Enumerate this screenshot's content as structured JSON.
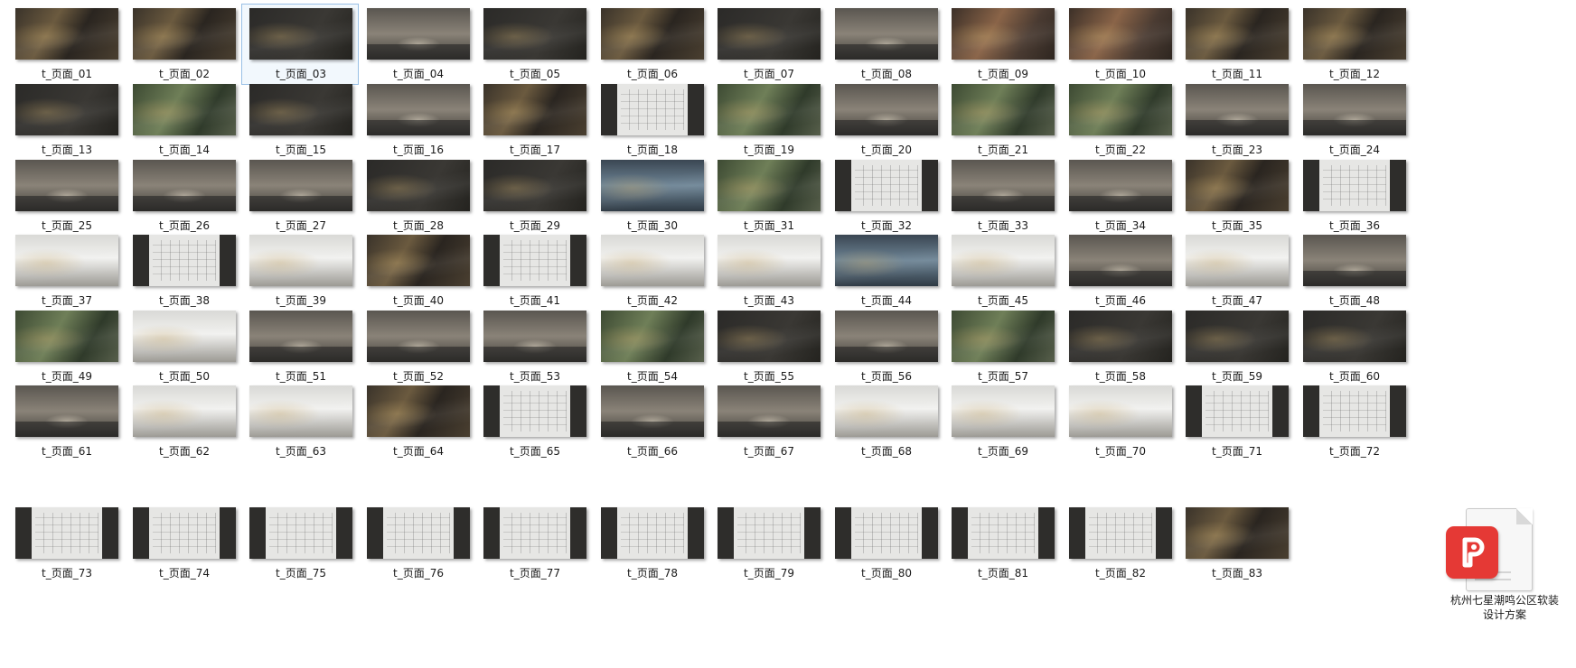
{
  "folder_items": [
    {
      "name": "t_页面_01",
      "style": "gold"
    },
    {
      "name": "t_页面_02",
      "style": "gold"
    },
    {
      "name": "t_页面_03",
      "style": "dark",
      "selected": true
    },
    {
      "name": "t_页面_04",
      "style": "room"
    },
    {
      "name": "t_页面_05",
      "style": "dark"
    },
    {
      "name": "t_页面_06",
      "style": "gold"
    },
    {
      "name": "t_页面_07",
      "style": "dark"
    },
    {
      "name": "t_页面_08",
      "style": "room"
    },
    {
      "name": "t_页面_09",
      "style": "people"
    },
    {
      "name": "t_页面_10",
      "style": "people"
    },
    {
      "name": "t_页面_11",
      "style": "gold"
    },
    {
      "name": "t_页面_12",
      "style": "gold"
    },
    {
      "name": "t_页面_13",
      "style": "dark"
    },
    {
      "name": "t_页面_14",
      "style": "green"
    },
    {
      "name": "t_页面_15",
      "style": "dark"
    },
    {
      "name": "t_页面_16",
      "style": "room"
    },
    {
      "name": "t_页面_17",
      "style": "gold"
    },
    {
      "name": "t_页面_18",
      "style": "plan"
    },
    {
      "name": "t_页面_19",
      "style": "green"
    },
    {
      "name": "t_页面_20",
      "style": "room"
    },
    {
      "name": "t_页面_21",
      "style": "green"
    },
    {
      "name": "t_页面_22",
      "style": "green"
    },
    {
      "name": "t_页面_23",
      "style": "room"
    },
    {
      "name": "t_页面_24",
      "style": "room"
    },
    {
      "name": "t_页面_25",
      "style": "room"
    },
    {
      "name": "t_页面_26",
      "style": "room"
    },
    {
      "name": "t_页面_27",
      "style": "room"
    },
    {
      "name": "t_页面_28",
      "style": "dark"
    },
    {
      "name": "t_页面_29",
      "style": "dark"
    },
    {
      "name": "t_页面_30",
      "style": "water"
    },
    {
      "name": "t_页面_31",
      "style": "green"
    },
    {
      "name": "t_页面_32",
      "style": "plan"
    },
    {
      "name": "t_页面_33",
      "style": "room"
    },
    {
      "name": "t_页面_34",
      "style": "room"
    },
    {
      "name": "t_页面_35",
      "style": "gold"
    },
    {
      "name": "t_页面_36",
      "style": "plan"
    },
    {
      "name": "t_页面_37",
      "style": "light"
    },
    {
      "name": "t_页面_38",
      "style": "plan"
    },
    {
      "name": "t_页面_39",
      "style": "light"
    },
    {
      "name": "t_页面_40",
      "style": "gold"
    },
    {
      "name": "t_页面_41",
      "style": "plan"
    },
    {
      "name": "t_页面_42",
      "style": "light"
    },
    {
      "name": "t_页面_43",
      "style": "light"
    },
    {
      "name": "t_页面_44",
      "style": "water"
    },
    {
      "name": "t_页面_45",
      "style": "light"
    },
    {
      "name": "t_页面_46",
      "style": "room"
    },
    {
      "name": "t_页面_47",
      "style": "light"
    },
    {
      "name": "t_页面_48",
      "style": "room"
    },
    {
      "name": "t_页面_49",
      "style": "green"
    },
    {
      "name": "t_页面_50",
      "style": "light"
    },
    {
      "name": "t_页面_51",
      "style": "room"
    },
    {
      "name": "t_页面_52",
      "style": "room"
    },
    {
      "name": "t_页面_53",
      "style": "room"
    },
    {
      "name": "t_页面_54",
      "style": "green"
    },
    {
      "name": "t_页面_55",
      "style": "dark"
    },
    {
      "name": "t_页面_56",
      "style": "room"
    },
    {
      "name": "t_页面_57",
      "style": "green"
    },
    {
      "name": "t_页面_58",
      "style": "dark"
    },
    {
      "name": "t_页面_59",
      "style": "dark"
    },
    {
      "name": "t_页面_60",
      "style": "dark"
    },
    {
      "name": "t_页面_61",
      "style": "room"
    },
    {
      "name": "t_页面_62",
      "style": "light"
    },
    {
      "name": "t_页面_63",
      "style": "light"
    },
    {
      "name": "t_页面_64",
      "style": "gold"
    },
    {
      "name": "t_页面_65",
      "style": "plan"
    },
    {
      "name": "t_页面_66",
      "style": "room"
    },
    {
      "name": "t_页面_67",
      "style": "room"
    },
    {
      "name": "t_页面_68",
      "style": "light"
    },
    {
      "name": "t_页面_69",
      "style": "light"
    },
    {
      "name": "t_页面_70",
      "style": "light"
    },
    {
      "name": "t_页面_71",
      "style": "plan"
    },
    {
      "name": "t_页面_72",
      "style": "plan"
    },
    {
      "name": "t_页面_73",
      "style": "plan"
    },
    {
      "name": "t_页面_74",
      "style": "plan"
    },
    {
      "name": "t_页面_75",
      "style": "plan"
    },
    {
      "name": "t_页面_76",
      "style": "plan"
    },
    {
      "name": "t_页面_77",
      "style": "plan"
    },
    {
      "name": "t_页面_78",
      "style": "plan"
    },
    {
      "name": "t_页面_79",
      "style": "plan"
    },
    {
      "name": "t_页面_80",
      "style": "plan"
    },
    {
      "name": "t_页面_81",
      "style": "plan"
    },
    {
      "name": "t_页面_82",
      "style": "plan"
    },
    {
      "name": "t_页面_83",
      "style": "gold"
    }
  ],
  "pdf_file": {
    "line1": "杭州七星潮鸣公区软装",
    "line2": "设计方案",
    "icon": "pdf-reader-icon",
    "badge_color": "#e53935"
  }
}
